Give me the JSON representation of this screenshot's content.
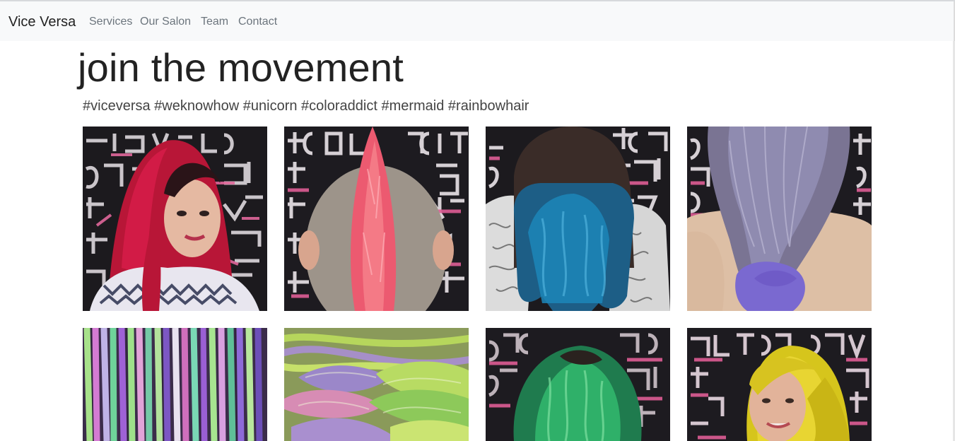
{
  "navbar": {
    "brand": "Vice Versa",
    "links": [
      {
        "label": "Services"
      },
      {
        "label": "Our Salon"
      },
      {
        "label": "Team"
      },
      {
        "label": "Contact"
      }
    ]
  },
  "main": {
    "headline": "join the movement",
    "hashtags": "#viceversa #weknowhow #unicorn #coloraddict #mermaid #rainbowhair"
  },
  "gallery": {
    "photos": [
      {
        "subject": "woman-red-hair"
      },
      {
        "subject": "pink-mohawk"
      },
      {
        "subject": "blue-ombre-hair"
      },
      {
        "subject": "lavender-hair"
      },
      {
        "subject": "rainbow-strands"
      },
      {
        "subject": "pastel-braid"
      },
      {
        "subject": "green-hair"
      },
      {
        "subject": "woman-yellow-hair"
      }
    ]
  },
  "colors": {
    "navbar_bg": "#f8f9fa",
    "nav_link": "#6c757d",
    "wall_dark": "#1c1a1e",
    "wall_paint": "#e0679a"
  }
}
